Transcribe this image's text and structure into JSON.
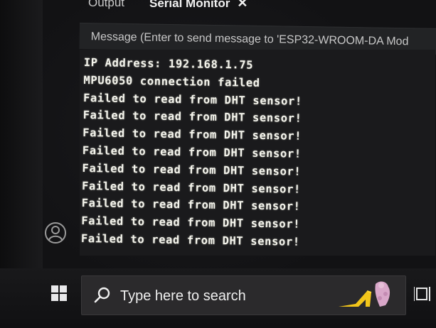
{
  "tabs": [
    {
      "label": "Output"
    },
    {
      "label": "Serial Monitor",
      "close_glyph": "✕"
    }
  ],
  "message_bar": {
    "placeholder": "Message (Enter to send message to 'ESP32-WROOM-DA Mod"
  },
  "serial_output": [
    "IP Address: 192.168.1.75",
    "MPU6050 connection failed",
    "Failed to read from DHT sensor!",
    "Failed to read from DHT sensor!",
    "Failed to read from DHT sensor!",
    "Failed to read from DHT sensor!",
    "Failed to read from DHT sensor!",
    "Failed to read from DHT sensor!",
    "Failed to read from DHT sensor!",
    "Failed to read from DHT sensor!",
    "Failed to read from DHT sensor!"
  ],
  "taskbar": {
    "search_placeholder": "Type here to search",
    "start_icon": "windows-logo-icon",
    "search_icon": "search-icon",
    "highlight_icon": "high-heel-icon",
    "taskview_icon": "task-view-icon"
  },
  "colors": {
    "console_text": "#f4f4ec",
    "console_bg": "#1a1a1c",
    "taskbar_bg": "#19191b"
  }
}
